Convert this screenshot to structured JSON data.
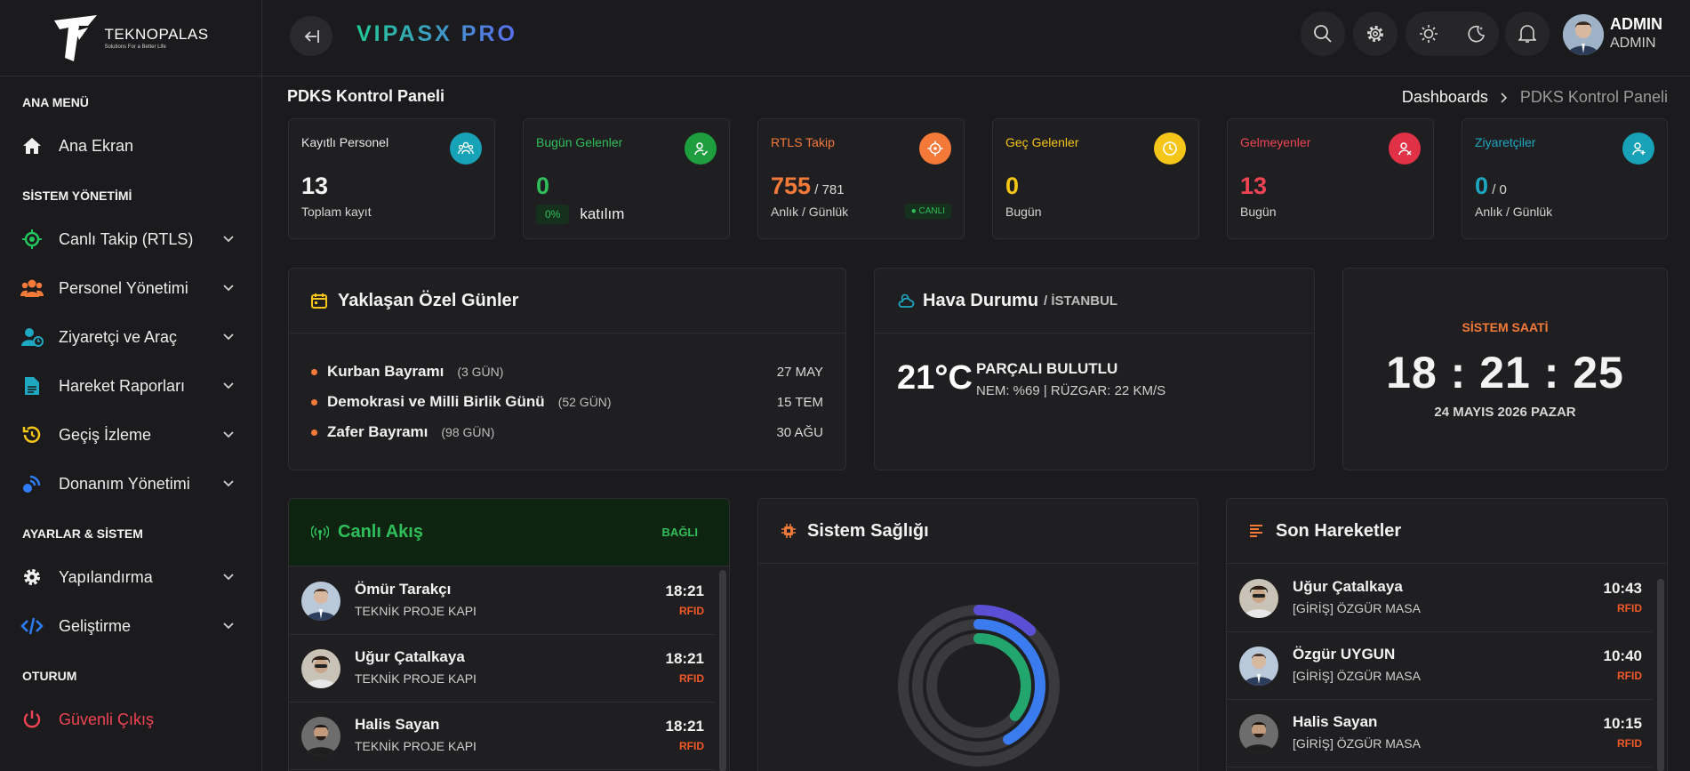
{
  "brand": {
    "logo_name": "TEKNOPALAS",
    "logo_sub": "Solutions For a Better Life",
    "app_title": "VIPASX PRO"
  },
  "header": {
    "user_name": "ADMIN",
    "user_role": "ADMIN"
  },
  "sidebar": {
    "sections": [
      "ANA MENÜ",
      "SİSTEM YÖNETİMİ",
      "AYARLAR & SİSTEM",
      "OTURUM"
    ],
    "items": [
      {
        "label": "Ana Ekran",
        "icon": "home-icon",
        "color": "#f0f0f0"
      },
      {
        "label": "Canlı Takip (RTLS)",
        "icon": "crosshair-icon",
        "color": "#22c55e"
      },
      {
        "label": "Personel Yönetimi",
        "icon": "users-icon",
        "color": "#f47a3a"
      },
      {
        "label": "Ziyaretçi ve Araç",
        "icon": "visitor-icon",
        "color": "#1ea7c1"
      },
      {
        "label": "Hareket Raporları",
        "icon": "document-icon",
        "color": "#1ea7c1"
      },
      {
        "label": "Geçiş İzleme",
        "icon": "history-icon",
        "color": "#f5c518"
      },
      {
        "label": "Donanım Yönetimi",
        "icon": "hardware-icon",
        "color": "#2f7df6"
      },
      {
        "label": "Yapılandırma",
        "icon": "gear-icon",
        "color": "#f0f0f0"
      },
      {
        "label": "Geliştirme",
        "icon": "code-icon",
        "color": "#2f7df6"
      },
      {
        "label": "Güvenli Çıkış",
        "icon": "power-icon",
        "color": "#ef4453"
      }
    ]
  },
  "page": {
    "title": "PDKS Kontrol Paneli",
    "breadcrumb": [
      "Dashboards",
      "PDKS Kontrol Paneli"
    ]
  },
  "stats": [
    {
      "title": "Kayıtlı Personel",
      "value": "13",
      "suffix": "",
      "sub": "Toplam kayıt",
      "title_color": "#e8e8e8",
      "value_color": "#f5f5f5",
      "icon_bg": "#17a2b8",
      "icon": "team-icon"
    },
    {
      "title": "Bugün Gelenler",
      "value": "0",
      "suffix": "",
      "pill": "0%",
      "sub": "katılım",
      "title_color": "#2fbf5a",
      "value_color": "#2fbf5a",
      "icon_bg": "#1e9e3f",
      "icon": "user-check-icon"
    },
    {
      "title": "RTLS Takip",
      "value": "755",
      "suffix": " / 781",
      "sub": "Anlık / Günlük",
      "badge": "● CANLI",
      "title_color": "#f47a3a",
      "value_color": "#f47a3a",
      "icon_bg": "#f47a3a",
      "icon": "target-icon"
    },
    {
      "title": "Geç Gelenler",
      "value": "0",
      "suffix": "",
      "sub": "Bugün",
      "title_color": "#f5c518",
      "value_color": "#f5c518",
      "icon_bg": "#f5c518",
      "icon": "clock-icon"
    },
    {
      "title": "Gelmeyenler",
      "value": "13",
      "suffix": "",
      "sub": "Bugün",
      "title_color": "#ef4453",
      "value_color": "#ef4453",
      "icon_bg": "#e03147",
      "icon": "user-x-icon"
    },
    {
      "title": "Ziyaretçiler",
      "value": "0",
      "suffix": " / 0",
      "sub": "Anlık / Günlük",
      "title_color": "#1ea7c1",
      "value_color": "#1ea7c1",
      "icon_bg": "#17a2b8",
      "icon": "visitor-icon"
    }
  ],
  "holidays": {
    "title": "Yaklaşan Özel Günler",
    "items": [
      {
        "name": "Kurban Bayramı",
        "days": "(3 GÜN)",
        "date": "27 MAY"
      },
      {
        "name": "Demokrasi ve Milli Birlik Günü",
        "days": "(52 GÜN)",
        "date": "15 TEM"
      },
      {
        "name": "Zafer Bayramı",
        "days": "(98 GÜN)",
        "date": "30 AĞU"
      }
    ]
  },
  "weather": {
    "title": "Hava Durumu",
    "city": "/ İSTANBUL",
    "temp": "21°C",
    "condition": "PARÇALI BULUTLU",
    "detail": "NEM: %69 | RÜZGAR: 22 KM/S"
  },
  "clock": {
    "label": "SİSTEM SAATİ",
    "time": "18 : 21 : 25",
    "date": "24 MAYIS 2026 PAZAR"
  },
  "live_feed": {
    "title": "Canlı Akış",
    "status": "BAĞLI",
    "rows": [
      {
        "name": "Ömür Tarakçı",
        "location": "TEKNİK PROJE KAPI",
        "time": "18:21",
        "method": "RFID"
      },
      {
        "name": "Uğur Çatalkaya",
        "location": "TEKNİK PROJE KAPI",
        "time": "18:21",
        "method": "RFID"
      },
      {
        "name": "Halis Sayan",
        "location": "TEKNİK PROJE KAPI",
        "time": "18:21",
        "method": "RFID"
      }
    ]
  },
  "system_health": {
    "title": "Sistem Sağlığı",
    "rings": [
      {
        "value": 0.12,
        "color": "#5b4fd6"
      },
      {
        "value": 0.42,
        "color": "#3a7bf0"
      },
      {
        "value": 0.36,
        "color": "#22a66e"
      }
    ]
  },
  "recent_moves": {
    "title": "Son Hareketler",
    "rows": [
      {
        "name": "Uğur Çatalkaya",
        "location": "[GİRİŞ] ÖZGÜR MASA",
        "time": "10:43",
        "method": "RFID"
      },
      {
        "name": "Özgür UYGUN",
        "location": "[GİRİŞ] ÖZGÜR MASA",
        "time": "10:40",
        "method": "RFID"
      },
      {
        "name": "Halis Sayan",
        "location": "[GİRİŞ] ÖZGÜR MASA",
        "time": "10:15",
        "method": "RFID"
      }
    ]
  }
}
